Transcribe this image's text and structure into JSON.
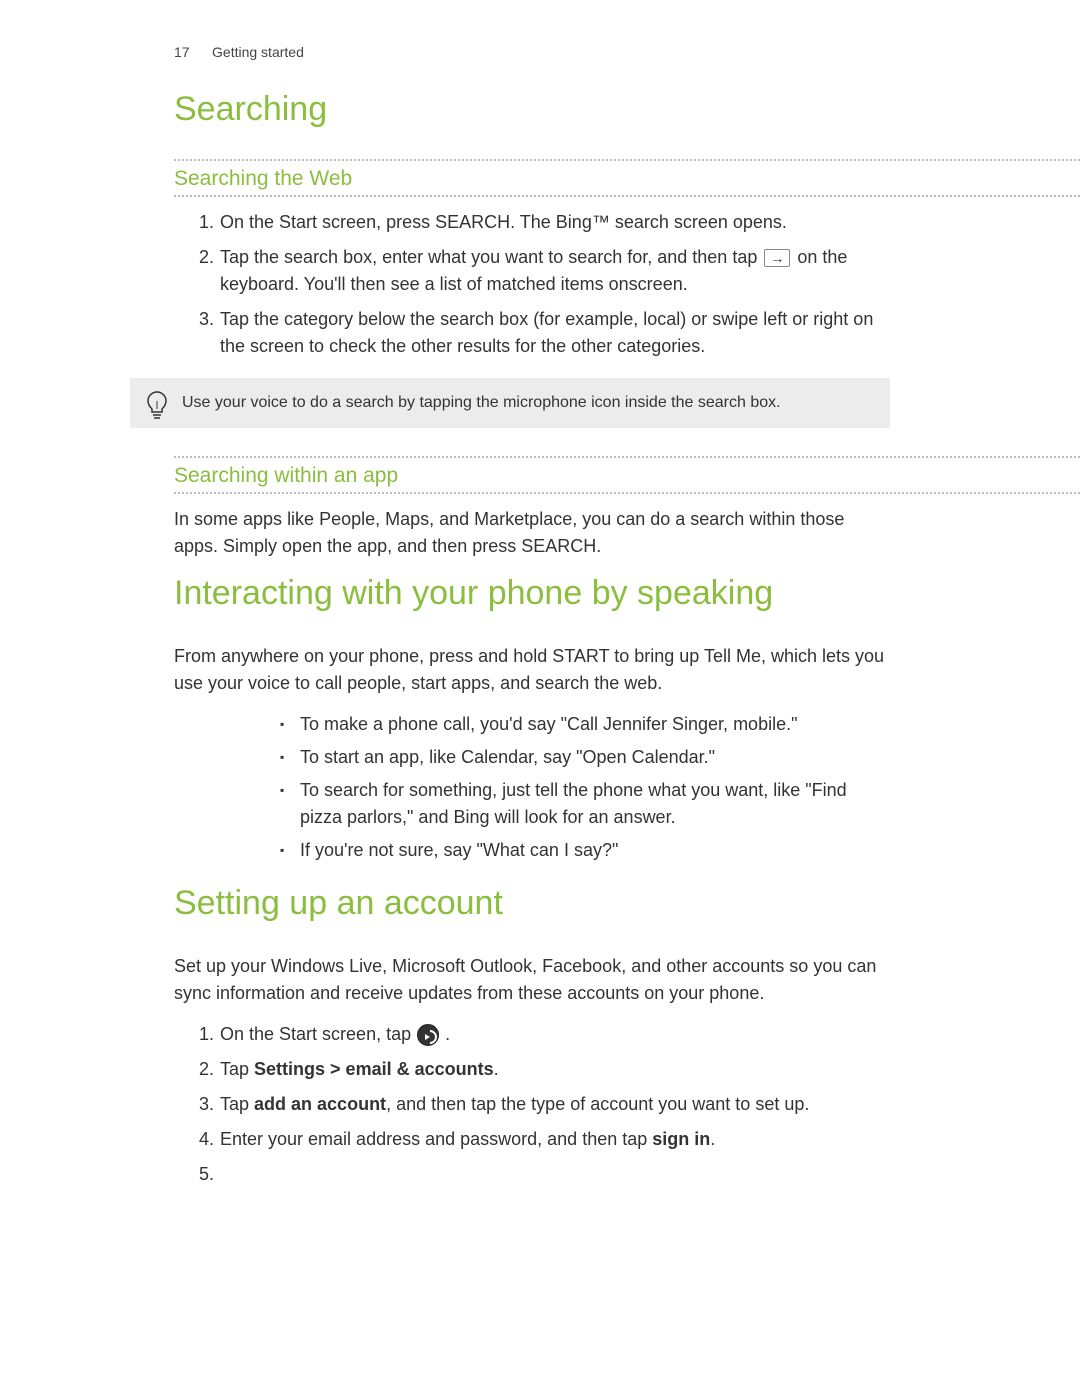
{
  "header": {
    "page_number": "17",
    "section": "Getting started"
  },
  "sections": {
    "searching": {
      "title": "Searching",
      "web": {
        "title": "Searching the Web",
        "steps": {
          "s1": "On the Start screen, press SEARCH. The Bing™ search screen opens.",
          "s2a": "Tap the search box, enter what you want to search for, and then tap ",
          "s2b": " on the keyboard. You'll then see a list of matched items onscreen.",
          "s3": "Tap the category below the search box (for example, local) or swipe left or right on the screen to check the other results for the other categories."
        },
        "key_icon_label": "→"
      },
      "tip": "Use your voice to do a search by tapping the microphone icon inside the search box.",
      "app": {
        "title": "Searching within an app",
        "body": "In some apps like People, Maps, and Marketplace, you can do a search within those apps. Simply open the app, and then press SEARCH."
      }
    },
    "speaking": {
      "title": "Interacting with your phone by speaking",
      "intro": "From anywhere on your phone, press and hold START to bring up Tell Me, which lets you use your voice to call people, start apps, and search the web.",
      "bullets": {
        "b1": "To make a phone call, you'd say \"Call Jennifer Singer, mobile.\"",
        "b2": "To start an app, like Calendar, say \"Open Calendar.\"",
        "b3": "To search for something, just tell the phone what you want, like \"Find pizza parlors,\" and Bing will look for an answer.",
        "b4": "If you're not sure, say \"What can I say?\""
      }
    },
    "account": {
      "title": "Setting up an account",
      "intro": "Set up your Windows Live, Microsoft Outlook, Facebook, and other accounts so you can sync information and receive updates from these accounts on your phone.",
      "steps": {
        "s1a": "On the Start screen, tap ",
        "s1b": ".",
        "s2a": "Tap ",
        "s2b": "Settings > email & accounts",
        "s2c": ".",
        "s3a": "Tap ",
        "s3b": "add an account",
        "s3c": ", and then tap the type of account you want to set up.",
        "s4a": "Enter your email address and password, and then tap ",
        "s4b": "sign in",
        "s4c": ".",
        "s5": ""
      }
    }
  }
}
